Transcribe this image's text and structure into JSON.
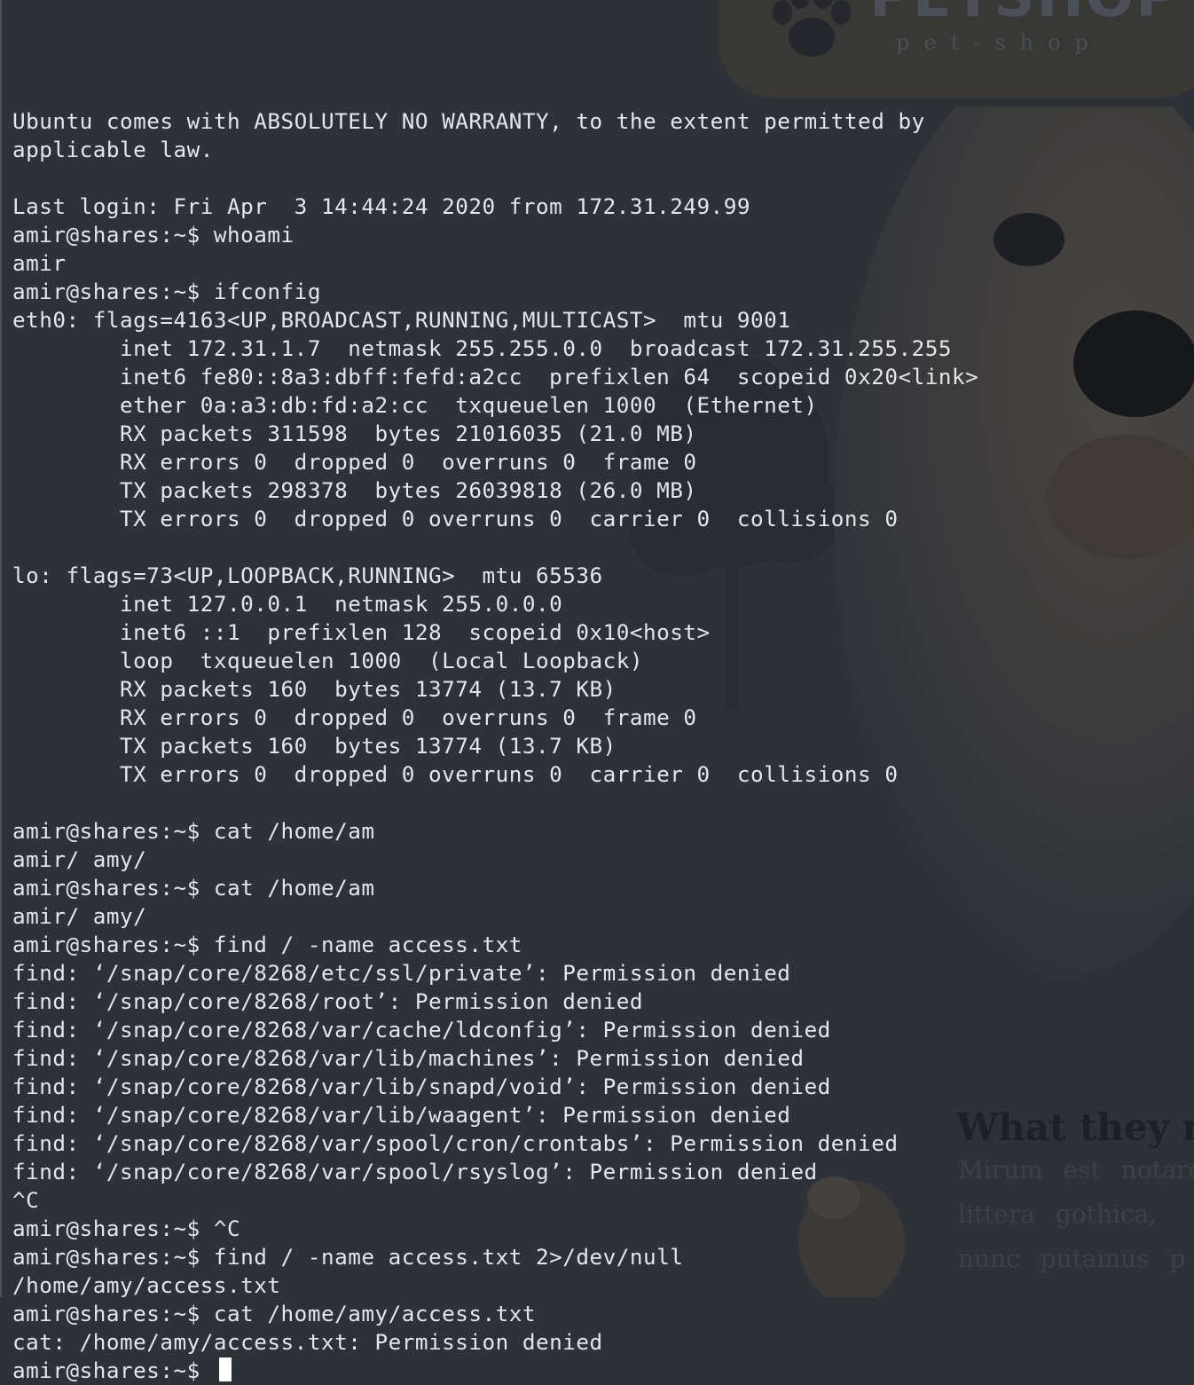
{
  "background_site": {
    "logo_text": "PETSHOP",
    "logo_subtext": "pet-shop",
    "heading": "What they n",
    "paragraph_lines": [
      "Mirum est notare",
      "littera gothica,",
      "nunc putamus p"
    ]
  },
  "terminal": {
    "lines": [
      "Ubuntu comes with ABSOLUTELY NO WARRANTY, to the extent permitted by",
      "applicable law.",
      "",
      "Last login: Fri Apr  3 14:44:24 2020 from 172.31.249.99",
      "amir@shares:~$ whoami",
      "amir",
      "amir@shares:~$ ifconfig",
      "eth0: flags=4163<UP,BROADCAST,RUNNING,MULTICAST>  mtu 9001",
      "        inet 172.31.1.7  netmask 255.255.0.0  broadcast 172.31.255.255",
      "        inet6 fe80::8a3:dbff:fefd:a2cc  prefixlen 64  scopeid 0x20<link>",
      "        ether 0a:a3:db:fd:a2:cc  txqueuelen 1000  (Ethernet)",
      "        RX packets 311598  bytes 21016035 (21.0 MB)",
      "        RX errors 0  dropped 0  overruns 0  frame 0",
      "        TX packets 298378  bytes 26039818 (26.0 MB)",
      "        TX errors 0  dropped 0 overruns 0  carrier 0  collisions 0",
      "",
      "lo: flags=73<UP,LOOPBACK,RUNNING>  mtu 65536",
      "        inet 127.0.0.1  netmask 255.0.0.0",
      "        inet6 ::1  prefixlen 128  scopeid 0x10<host>",
      "        loop  txqueuelen 1000  (Local Loopback)",
      "        RX packets 160  bytes 13774 (13.7 KB)",
      "        RX errors 0  dropped 0  overruns 0  frame 0",
      "        TX packets 160  bytes 13774 (13.7 KB)",
      "        TX errors 0  dropped 0 overruns 0  carrier 0  collisions 0",
      "",
      "amir@shares:~$ cat /home/am",
      "amir/ amy/",
      "amir@shares:~$ cat /home/am",
      "amir/ amy/",
      "amir@shares:~$ find / -name access.txt",
      "find: ‘/snap/core/8268/etc/ssl/private’: Permission denied",
      "find: ‘/snap/core/8268/root’: Permission denied",
      "find: ‘/snap/core/8268/var/cache/ldconfig’: Permission denied",
      "find: ‘/snap/core/8268/var/lib/machines’: Permission denied",
      "find: ‘/snap/core/8268/var/lib/snapd/void’: Permission denied",
      "find: ‘/snap/core/8268/var/lib/waagent’: Permission denied",
      "find: ‘/snap/core/8268/var/spool/cron/crontabs’: Permission denied",
      "find: ‘/snap/core/8268/var/spool/rsyslog’: Permission denied",
      "^C",
      "amir@shares:~$ ^C",
      "amir@shares:~$ find / -name access.txt 2>/dev/null",
      "/home/amy/access.txt",
      "amir@shares:~$ cat /home/amy/access.txt",
      "cat: /home/amy/access.txt: Permission denied"
    ],
    "prompt": "amir@shares:~$ "
  },
  "colors": {
    "terminal_text": "#e4e6ea",
    "background": "#2d3138",
    "cursor": "#ffffff"
  }
}
